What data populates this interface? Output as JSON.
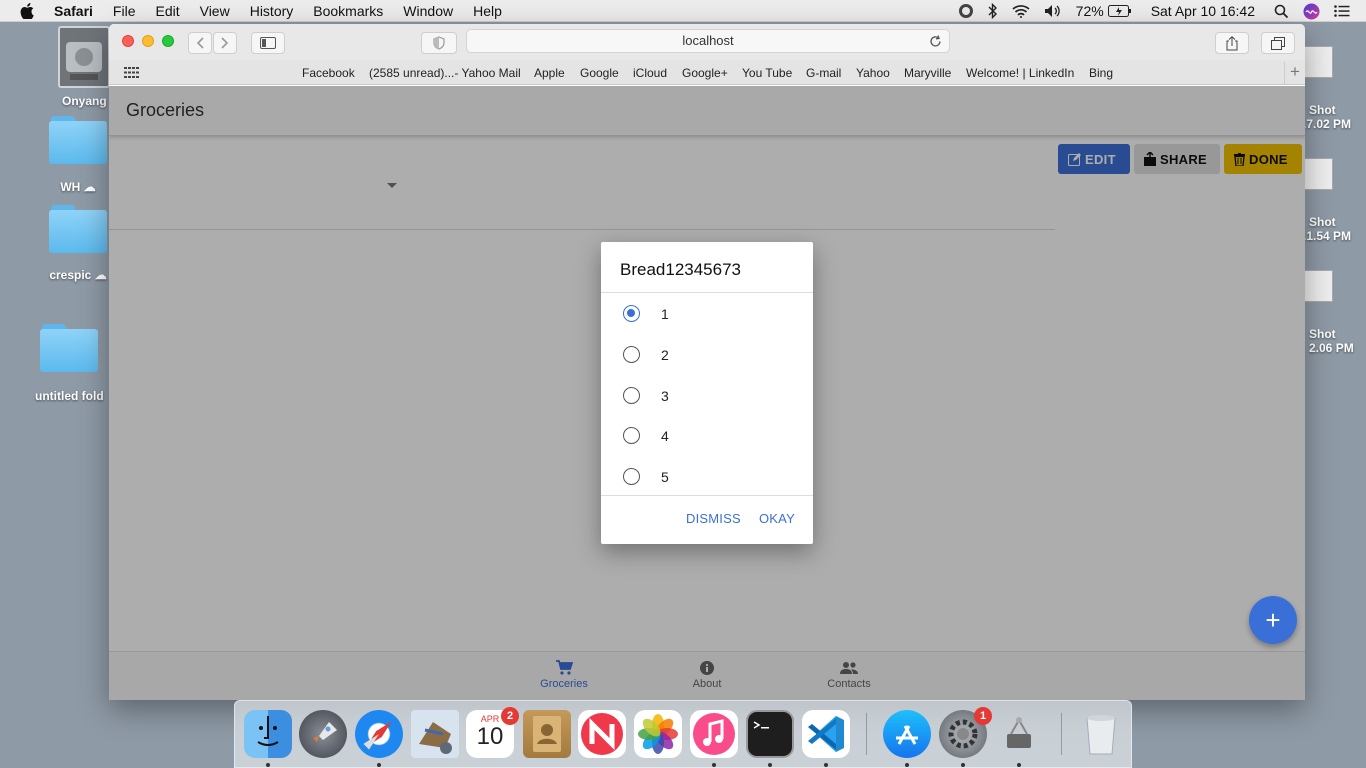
{
  "menubar": {
    "app": "Safari",
    "items": [
      "File",
      "Edit",
      "View",
      "History",
      "Bookmarks",
      "Window",
      "Help"
    ],
    "battery": "72%",
    "clock": "Sat Apr 10  16:42"
  },
  "desktop": {
    "icons": [
      "Onyang",
      "WH",
      "crespic",
      "untitled fold"
    ],
    "shots": [
      {
        "l1": "Shot",
        "l2": ".7.02 PM"
      },
      {
        "l1": "Shot",
        "l2": ".1.54 PM"
      },
      {
        "l1": "Shot",
        "l2": "2.06 PM"
      }
    ]
  },
  "browser": {
    "url": "localhost",
    "bookmarks": [
      "Facebook",
      "(2585 unread)...- Yahoo Mail",
      "Apple",
      "Google",
      "iCloud",
      "Google+",
      "You Tube",
      "G-mail",
      "Yahoo",
      "Maryville",
      "Welcome! | LinkedIn",
      "Bing"
    ]
  },
  "page": {
    "title": "Groceries",
    "actions": {
      "edit": "EDIT",
      "share": "SHARE",
      "done": "DONE"
    },
    "tabs": [
      "Groceries",
      "About",
      "Contacts"
    ],
    "fab": "+"
  },
  "dialog": {
    "title": "Bread12345673",
    "options": [
      "1",
      "2",
      "3",
      "4",
      "5"
    ],
    "selected": "1",
    "dismiss": "DISMISS",
    "okay": "OKAY"
  },
  "dock": {
    "calendar_month": "APR",
    "calendar_day": "10",
    "calendar_badge": "2",
    "prefs_badge": "1"
  },
  "colors": {
    "accent": "#3b6fd8",
    "edit": "#3b6fd8",
    "done": "#f2c100",
    "share": "#e0e0e0"
  }
}
